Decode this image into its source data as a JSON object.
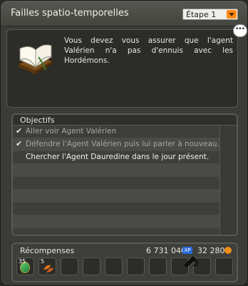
{
  "window": {
    "title": "Failles spatio-temporelles"
  },
  "step_select": {
    "selected": "Étape 1"
  },
  "description": {
    "text": "Vous devez vous assurer que l'agent Valérien n'a pas d'ennuis avec les Hordémons."
  },
  "objectives": {
    "header": "Objectifs",
    "items": [
      {
        "label": "Aller voir Agent Valérien",
        "done": true
      },
      {
        "label": "Défendre l'Agent Valérien puis lui parler à nouveau.",
        "done": true
      },
      {
        "label": "Chercher l'Agent Dauredine dans le jour présent.",
        "done": false
      }
    ],
    "check_glyph": "✔"
  },
  "rewards": {
    "label": "Récompenses",
    "xp": "6 731 040",
    "xp_icon_text": "XP",
    "kamas": "32 280",
    "items": [
      {
        "qty": "35",
        "icon": "emerald-gem-icon"
      },
      {
        "qty": "5",
        "icon": "autumn-leaves-icon"
      }
    ]
  },
  "colors": {
    "accent_orange": "#ff8a16",
    "xp_blue": "#2a6adf",
    "kamas_gold": "#f08c18"
  }
}
